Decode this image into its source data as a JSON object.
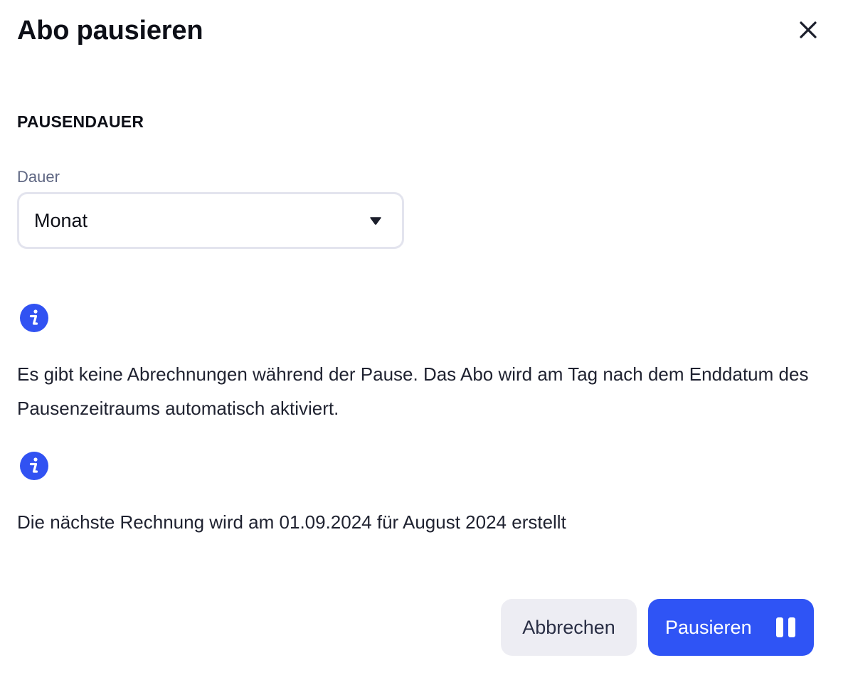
{
  "dialog": {
    "title": "Abo pausieren",
    "close_icon": "close-icon"
  },
  "section": {
    "heading": "PAUSENDAUER"
  },
  "duration_field": {
    "label": "Dauer",
    "value": "Monat",
    "caret_icon": "caret-down-icon"
  },
  "info": [
    {
      "icon": "info-icon",
      "text": "Es gibt keine Abrechnungen während der Pause. Das Abo wird am Tag nach dem Enddatum des Pausenzeitraums automatisch aktiviert."
    },
    {
      "icon": "info-icon",
      "text": "Die nächste Rechnung wird am 01.09.2024 für August 2024 erstellt"
    }
  ],
  "actions": {
    "cancel_label": "Abbrechen",
    "pause_label": "Pausieren",
    "pause_icon": "pause-icon"
  },
  "colors": {
    "accent": "#2f54f5",
    "info_icon": "#3152f2",
    "cancel_bg": "#ededf3",
    "field_border": "#e3e4ee",
    "muted_label": "#5f6783"
  }
}
